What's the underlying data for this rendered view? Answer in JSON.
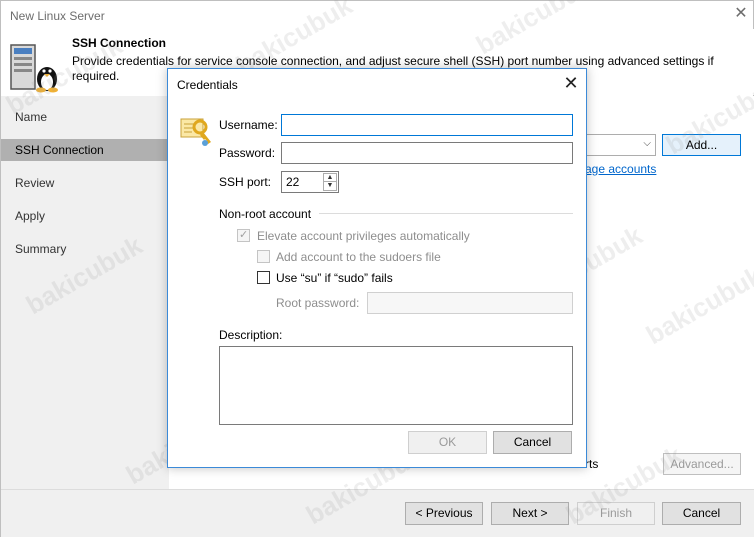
{
  "window": {
    "title": "New Linux Server",
    "close_glyph": "✕"
  },
  "header": {
    "title": "SSH Connection",
    "description": "Provide credentials for service console connection, and adjust secure shell (SSH) port number using advanced settings if required."
  },
  "steps": [
    {
      "label": "Name",
      "active": false
    },
    {
      "label": "SSH Connection",
      "active": true
    },
    {
      "label": "Review",
      "active": false
    },
    {
      "label": "Apply",
      "active": false
    },
    {
      "label": "Summary",
      "active": false
    }
  ],
  "background": {
    "add_button": "Add...",
    "manage_accounts_link": "age accounts",
    "ports_text": "rts",
    "advanced_button": "Advanced..."
  },
  "footer": {
    "previous": "< Previous",
    "next": "Next >",
    "finish": "Finish",
    "cancel": "Cancel"
  },
  "dialog": {
    "title": "Credentials",
    "close_glyph": "✕",
    "username_label": "Username:",
    "username_value": "",
    "password_label": "Password:",
    "password_value": "",
    "ssh_port_label": "SSH port:",
    "ssh_port_value": "22",
    "non_root_group": "Non-root account",
    "elevate_label": "Elevate account privileges automatically",
    "elevate_checked": true,
    "sudoers_label": "Add account to the sudoers file",
    "sudoers_checked": false,
    "su_label": "Use “su” if “sudo” fails",
    "su_checked": false,
    "root_password_label": "Root password:",
    "description_label": "Description:",
    "description_value": "",
    "ok_button": "OK",
    "cancel_button": "Cancel"
  },
  "watermark": "bakicubuk",
  "colors": {
    "accent": "#0078d7",
    "link": "#0066cc",
    "active_step": "#b0b0b0"
  }
}
